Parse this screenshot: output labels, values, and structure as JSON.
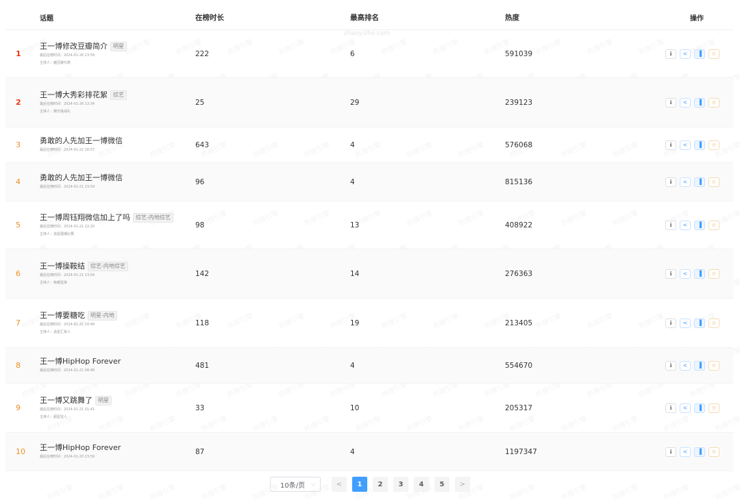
{
  "watermark": {
    "site": "zhaoyizhe.com",
    "text": "热搜引擎"
  },
  "table": {
    "headers": {
      "topic": "话题",
      "duration": "在榜时长",
      "best_rank": "最高排名",
      "heat": "热度",
      "ops": "操作"
    },
    "rows": [
      {
        "rank": "1",
        "title": "王一博修改豆瓣简介",
        "tag": "明星",
        "last_time": "最后在榜时间：2024-01-26 23:59",
        "host": "主持人：鹿豆瓣代表",
        "duration": "222",
        "best_rank": "6",
        "heat": "591039"
      },
      {
        "rank": "2",
        "title": "王一博大秀彩排花絮",
        "tag": "综艺",
        "last_time": "最后在榜时间：2024-01-26 13:34",
        "host": "主持人：娱乐挑战礼",
        "duration": "25",
        "best_rank": "29",
        "heat": "239123"
      },
      {
        "rank": "3",
        "title": "勇敢的人先加王一博微信",
        "tag": "",
        "last_time": "最后在榜时间：2024-01-22 16:57",
        "host": "",
        "duration": "643",
        "best_rank": "4",
        "heat": "576068"
      },
      {
        "rank": "4",
        "title": "勇敢的人先加王一博微信",
        "tag": "",
        "last_time": "最后在榜时间：2024-01-21 23:59",
        "host": "",
        "duration": "96",
        "best_rank": "4",
        "heat": "815136"
      },
      {
        "rank": "5",
        "title": "王一博周钰翔微信加上了吗",
        "tag": "综艺-内地综艺",
        "last_time": "最后在榜时间：2024-01-21 22:20",
        "host": "主持人：追星展播比赛",
        "duration": "98",
        "best_rank": "13",
        "heat": "408922"
      },
      {
        "rank": "6",
        "title": "王一博操鞍结",
        "tag": "综艺-内地综艺",
        "last_time": "最后在榜时间：2024-01-21 13:54",
        "host": "主持人：吸暖星库",
        "duration": "142",
        "best_rank": "14",
        "heat": "276363"
      },
      {
        "rank": "7",
        "title": "王一博要糖吃",
        "tag": "明星-内地",
        "last_time": "最后在榜时间：2024-01-21 10:48",
        "host": "主持人：追星汇家人",
        "duration": "118",
        "best_rank": "19",
        "heat": "213405"
      },
      {
        "rank": "8",
        "title": "王一博HipHop Forever",
        "tag": "",
        "last_time": "最后在榜时间：2024-01-21 08:48",
        "host": "",
        "duration": "481",
        "best_rank": "4",
        "heat": "554670"
      },
      {
        "rank": "9",
        "title": "王一博又跳舞了",
        "tag": "明星",
        "last_time": "最后在榜时间：2024-01-21 01:41",
        "host": "主持人：超星狂人",
        "duration": "33",
        "best_rank": "10",
        "heat": "205317"
      },
      {
        "rank": "10",
        "title": "王一博HipHop Forever",
        "tag": "",
        "last_time": "最后在榜时间：2024-01-20 23:59",
        "host": "",
        "duration": "87",
        "best_rank": "4",
        "heat": "1197347"
      }
    ],
    "ops_icons": [
      "info-icon",
      "share-icon",
      "chart-icon",
      "star-icon"
    ]
  },
  "pagination": {
    "page_size": "10条/页",
    "pages": [
      "1",
      "2",
      "3",
      "4",
      "5"
    ],
    "current": "1",
    "prev": "<",
    "next": ">"
  },
  "colors": {
    "rank_top": "#e8370f",
    "rank_mid": "#f08c21",
    "accent": "#409eff",
    "star": "#e6a23c"
  }
}
